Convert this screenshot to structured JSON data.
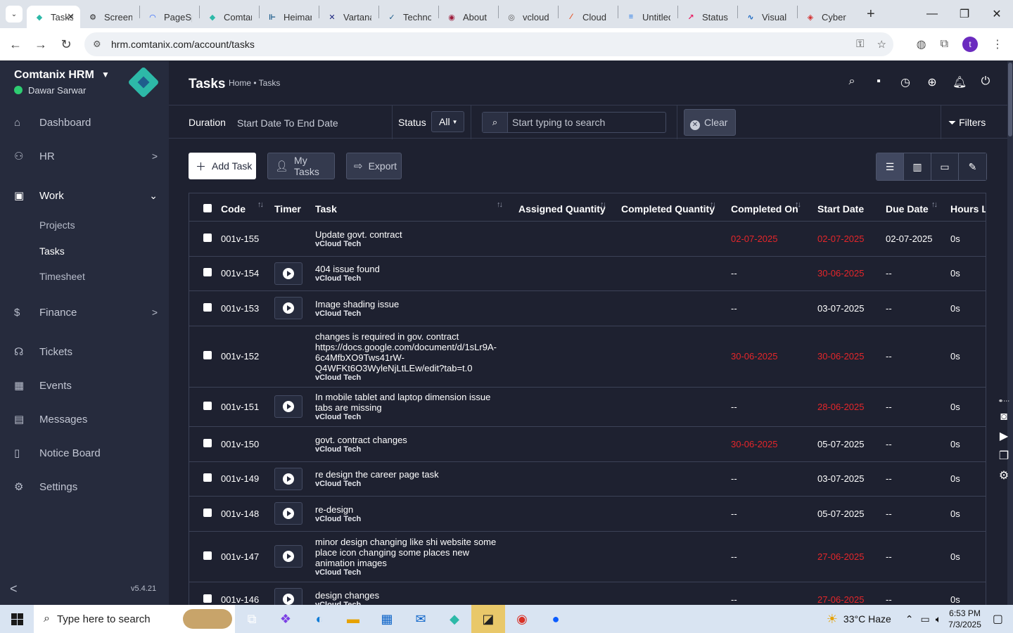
{
  "browser": {
    "tabs": [
      {
        "label": "Tasks",
        "color": "#2db9a8",
        "glyph": "◆"
      },
      {
        "label": "Screencast",
        "color": "#222222",
        "glyph": "⚙"
      },
      {
        "label": "PageSpeed",
        "color": "#2962ff",
        "glyph": "◠"
      },
      {
        "label": "Comtanix",
        "color": "#2db9a8",
        "glyph": "◆"
      },
      {
        "label": "Heimar",
        "color": "#1f5e8c",
        "glyph": "⊩"
      },
      {
        "label": "Vartana",
        "color": "#1a237e",
        "glyph": "✕"
      },
      {
        "label": "Technology",
        "color": "#1f5e8c",
        "glyph": "✓"
      },
      {
        "label": "About",
        "color": "#9c1b3a",
        "glyph": "◉"
      },
      {
        "label": "vcloud",
        "color": "#555555",
        "glyph": "◎"
      },
      {
        "label": "Cloud",
        "color": "#e64a19",
        "glyph": "⁄"
      },
      {
        "label": "Untitled",
        "color": "#1a73e8",
        "glyph": "≡"
      },
      {
        "label": "Status",
        "color": "#e91e63",
        "glyph": "↗"
      },
      {
        "label": "Visual",
        "color": "#1565c0",
        "glyph": "∿"
      },
      {
        "label": "Cyber",
        "color": "#d32f2f",
        "glyph": "◈"
      }
    ],
    "url": "hrm.comtanix.com/account/tasks",
    "profile_initial": "t"
  },
  "sidebar": {
    "brand": "Comtanix HRM",
    "user": "Dawar Sarwar",
    "items": [
      {
        "label": "Dashboard",
        "icon": "home-icon",
        "glyph": "⌂"
      },
      {
        "label": "HR",
        "icon": "users-icon",
        "glyph": "⚇"
      },
      {
        "label": "Work",
        "icon": "briefcase-icon",
        "glyph": "▣"
      },
      {
        "label": "Finance",
        "icon": "dollar-icon",
        "glyph": "$"
      },
      {
        "label": "Tickets",
        "icon": "headset-icon",
        "glyph": "☊"
      },
      {
        "label": "Events",
        "icon": "calendar-icon",
        "glyph": "▦"
      },
      {
        "label": "Messages",
        "icon": "message-icon",
        "glyph": "▤"
      },
      {
        "label": "Notice Board",
        "icon": "clipboard-icon",
        "glyph": "▯"
      },
      {
        "label": "Settings",
        "icon": "gear-icon",
        "glyph": "⚙"
      }
    ],
    "work_sub": [
      "Projects",
      "Tasks",
      "Timesheet"
    ],
    "version": "v5.4.21"
  },
  "header": {
    "title": "Tasks",
    "breadcrumb": "Home • Tasks"
  },
  "filters": {
    "duration_label": "Duration",
    "duration_value": "Start Date To End Date",
    "status_label": "Status",
    "status_value": "All",
    "search_placeholder": "Start typing to search",
    "clear_label": "Clear",
    "filters_label": "Filters"
  },
  "actions": {
    "add_task": "Add Task",
    "my_tasks": "My Tasks",
    "export": "Export"
  },
  "table": {
    "columns": [
      "Code",
      "Timer",
      "Task",
      "Assigned Quantity",
      "Completed Quantity",
      "Completed On",
      "Start Date",
      "Due Date",
      "Hours Log"
    ],
    "rows": [
      {
        "code": "001v-155",
        "timer": false,
        "task": "Update govt. contract",
        "client": "vCloud Tech",
        "completed_on": "02-07-2025",
        "completed_red": true,
        "start": "02-07-2025",
        "start_red": true,
        "due": "02-07-2025",
        "hours": "0s",
        "h": 50
      },
      {
        "code": "001v-154",
        "timer": true,
        "task": "404 issue found",
        "client": "vCloud Tech",
        "completed_on": "--",
        "completed_red": false,
        "start": "30-06-2025",
        "start_red": true,
        "due": "--",
        "hours": "0s",
        "h": 49
      },
      {
        "code": "001v-153",
        "timer": true,
        "task": "Image shading issue",
        "client": "vCloud Tech",
        "completed_on": "--",
        "completed_red": false,
        "start": "03-07-2025",
        "start_red": false,
        "due": "--",
        "hours": "0s",
        "h": 50
      },
      {
        "code": "001v-152",
        "timer": false,
        "task": "changes is required in gov. contract https://docs.google.com/document/d/1sLr9A-6c4MfbXO9Tws41rW-Q4WFKt6O3WyleNjLtLEw/edit?tab=t.0",
        "client": "vCloud Tech",
        "completed_on": "30-06-2025",
        "completed_red": true,
        "start": "30-06-2025",
        "start_red": true,
        "due": "--",
        "hours": "0s",
        "h": 87
      },
      {
        "code": "001v-151",
        "timer": true,
        "task": "In mobile tablet and laptop dimension issue tabs are missing",
        "client": "vCloud Tech",
        "completed_on": "--",
        "completed_red": false,
        "start": "28-06-2025",
        "start_red": true,
        "due": "--",
        "hours": "0s",
        "h": 56
      },
      {
        "code": "001v-150",
        "timer": false,
        "task": "govt. contract changes",
        "client": "vCloud Tech",
        "completed_on": "30-06-2025",
        "completed_red": true,
        "start": "05-07-2025",
        "start_red": false,
        "due": "--",
        "hours": "0s",
        "h": 50
      },
      {
        "code": "001v-149",
        "timer": true,
        "task": "re design the career page task",
        "client": "vCloud Tech",
        "completed_on": "--",
        "completed_red": false,
        "start": "03-07-2025",
        "start_red": false,
        "due": "--",
        "hours": "0s",
        "h": 49
      },
      {
        "code": "001v-148",
        "timer": true,
        "task": "re-design",
        "client": "vCloud Tech",
        "completed_on": "--",
        "completed_red": false,
        "start": "05-07-2025",
        "start_red": false,
        "due": "--",
        "hours": "0s",
        "h": 50
      },
      {
        "code": "001v-147",
        "timer": true,
        "task": "minor design changing like shi website some place icon changing some places new animation images",
        "client": "vCloud Tech",
        "completed_on": "--",
        "completed_red": false,
        "start": "27-06-2025",
        "start_red": true,
        "due": "--",
        "hours": "0s",
        "h": 72
      },
      {
        "code": "001v-146",
        "timer": true,
        "task": "design changes",
        "client": "vCloud Tech",
        "completed_on": "--",
        "completed_red": false,
        "start": "27-06-2025",
        "start_red": true,
        "due": "--",
        "hours": "0s",
        "h": 50
      }
    ]
  },
  "taskbar": {
    "search_placeholder": "Type here to search",
    "weather": "33°C  Haze",
    "time": "6:53 PM",
    "date": "7/3/2025"
  }
}
